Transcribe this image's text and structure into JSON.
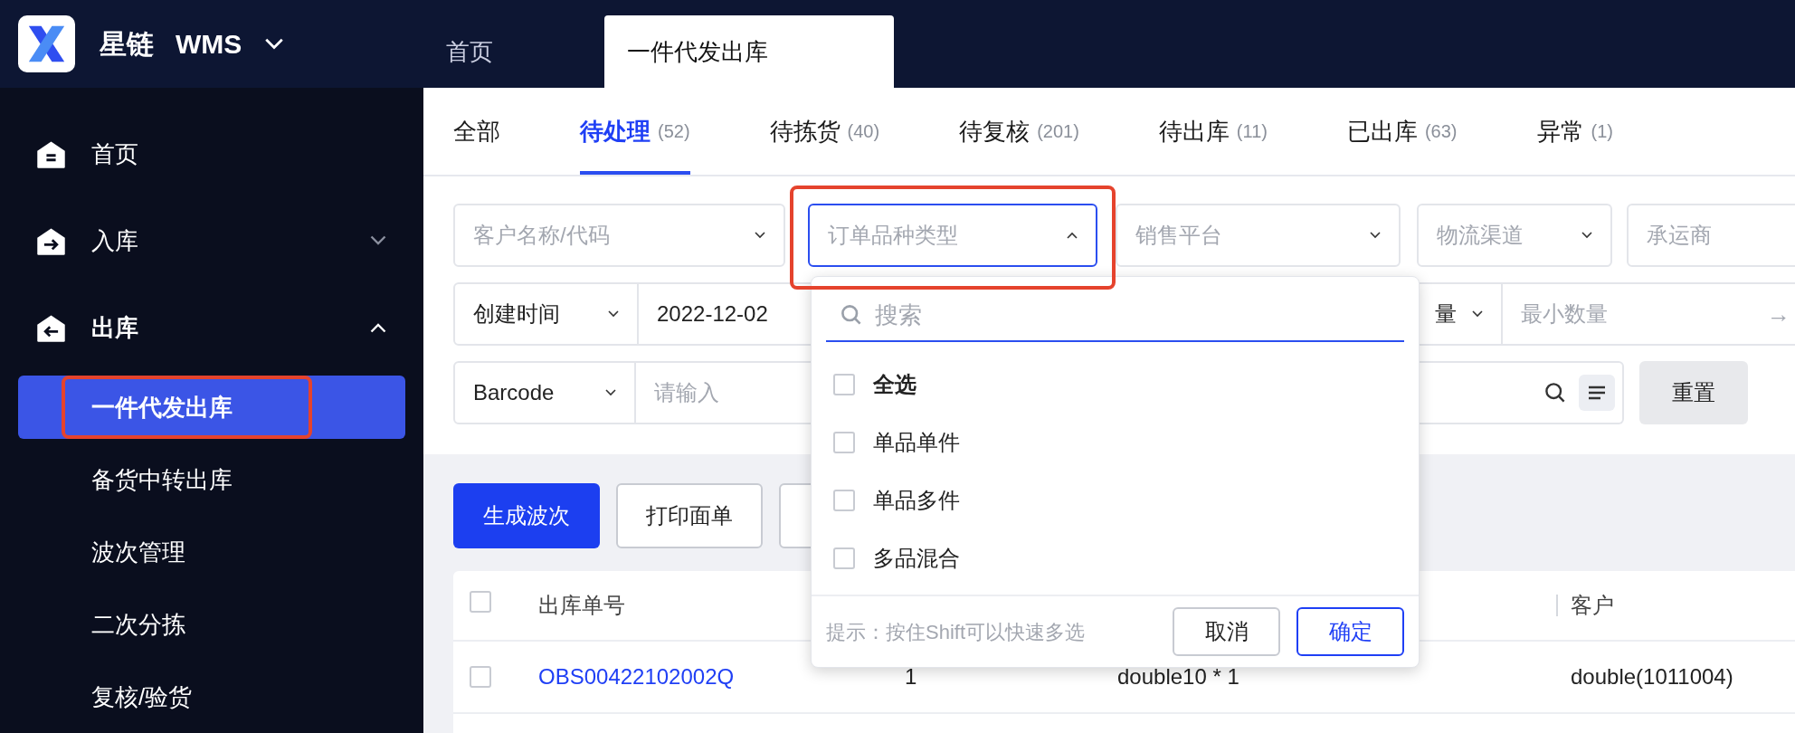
{
  "app": {
    "brand": "星链",
    "product": "WMS"
  },
  "header_tabs": [
    {
      "label": "首页",
      "selected": false
    },
    {
      "label": "一件代发出库",
      "selected": true
    }
  ],
  "sidebar": {
    "items": [
      {
        "label": "首页"
      },
      {
        "label": "入库",
        "expanded": false
      },
      {
        "label": "出库",
        "expanded": true,
        "children": [
          {
            "label": "一件代发出库",
            "selected": true
          },
          {
            "label": "备货中转出库",
            "selected": false
          },
          {
            "label": "波次管理",
            "selected": false
          },
          {
            "label": "二次分拣",
            "selected": false
          },
          {
            "label": "复核/验货",
            "selected": false
          }
        ]
      }
    ]
  },
  "status_tabs": [
    {
      "label": "全部",
      "selected": false
    },
    {
      "label": "待处理",
      "count": "(52)",
      "selected": true
    },
    {
      "label": "待拣货",
      "count": "(40)",
      "selected": false
    },
    {
      "label": "待复核",
      "count": "(201)",
      "selected": false
    },
    {
      "label": "待出库",
      "count": "(11)",
      "selected": false
    },
    {
      "label": "已出库",
      "count": "(63)",
      "selected": false
    },
    {
      "label": "异常",
      "count": "(1)",
      "selected": false
    }
  ],
  "filters": {
    "row_1": [
      {
        "placeholder": "客户名称/代码",
        "open": false
      },
      {
        "placeholder": "订单品种类型",
        "open": true
      },
      {
        "placeholder": "销售平台",
        "open": false
      },
      {
        "placeholder": "物流渠道",
        "open": false
      },
      {
        "placeholder": "承运商"
      }
    ],
    "time_type": "创建时间",
    "date_value": "2022-12-02",
    "quantity_type": "量",
    "min_quantity_placeholder": "最小数量",
    "arrow": "→",
    "code_type": "Barcode",
    "code_placeholder": "请输入",
    "reset": "重置"
  },
  "dropdown": {
    "search_placeholder": "搜索",
    "options": [
      {
        "label": "全选",
        "kind": "all",
        "checked": false
      },
      {
        "label": "单品单件",
        "kind": "option",
        "checked": false
      },
      {
        "label": "单品多件",
        "kind": "option",
        "checked": false
      },
      {
        "label": "多品混合",
        "kind": "option",
        "checked": false
      }
    ],
    "hint": "提示：按住Shift可以快速多选",
    "cancel": "取消",
    "confirm": "确定"
  },
  "actions": [
    {
      "label": "生成波次",
      "kind": "primary"
    },
    {
      "label": "打印面单",
      "kind": "default"
    },
    {
      "kind": "hidden"
    }
  ],
  "table": {
    "all_checked": false,
    "columns": [
      "出库单号",
      "客户"
    ],
    "rows": [
      {
        "checked": false,
        "order_no": "OBS00422102002Q",
        "column_2": "1",
        "column_3": "double10 * 1",
        "customer": "double(1011004)"
      }
    ]
  }
}
